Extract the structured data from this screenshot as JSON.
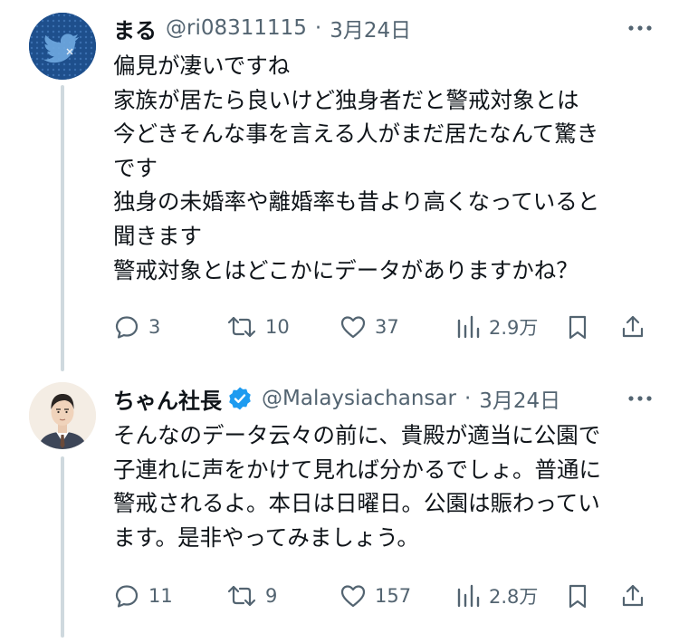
{
  "tweets": [
    {
      "name": "まる",
      "handle": "@ri08311115",
      "separator": "·",
      "date": "3月24日",
      "lines": [
        "偏見が凄いですね",
        "家族が居たら良いけど独身者だと警戒対象とは",
        "今どきそんな事を言える人がまだ居たなんて驚き",
        "です",
        "独身の未婚率や離婚率も昔より高くなっていると",
        "聞きます",
        "警戒対象とはどこかにデータがありますかね？"
      ],
      "replies": "3",
      "retweets": "10",
      "likes": "37",
      "views": "2.9万",
      "avatar_color": "#1e4f8c",
      "avatar_icon": "bird-logo-icon"
    },
    {
      "name": "ちゃん社長",
      "handle": "@Malaysiachansar",
      "separator": "·",
      "date": "3月24日",
      "verified": true,
      "lines": [
        "そんなのデータ云々の前に、貴殿が適当に公園で",
        "子連れに声をかけて見れば分かるでしょ。普通に",
        "警戒されるよ。本日は日曜日。公園は賑わってい",
        "ます。是非やってみましょう。"
      ],
      "replies": "11",
      "retweets": "9",
      "likes": "157",
      "views": "2.8万",
      "avatar_icon": "illustrated-man-portrait-icon"
    }
  ],
  "colors": {
    "text": "#0f1419",
    "secondary": "#536471",
    "thread_line": "#cfd9de",
    "verified": "#1d9bf0"
  }
}
